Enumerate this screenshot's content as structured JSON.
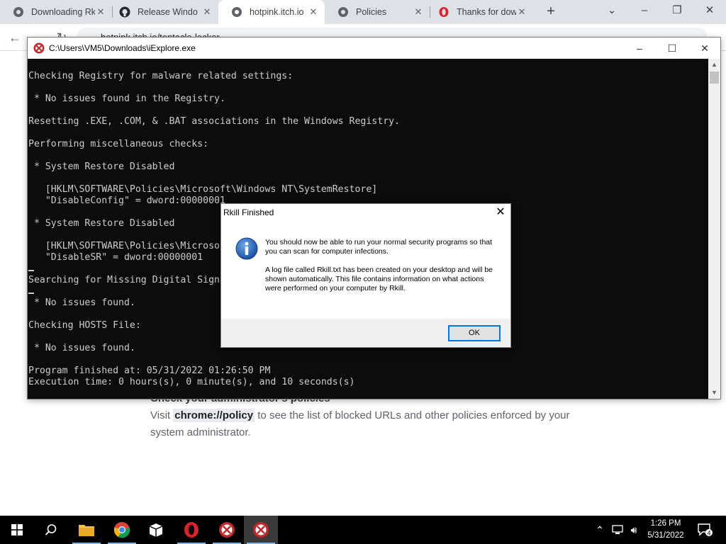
{
  "browser": {
    "tabs": [
      {
        "title": "Downloading Rk",
        "icon": "chrome-page-icon"
      },
      {
        "title": "Release Windo",
        "icon": "github-icon"
      },
      {
        "title": "hotpink.itch.io",
        "icon": "chrome-page-icon"
      },
      {
        "title": "Policies",
        "icon": "chrome-page-icon"
      },
      {
        "title": "Thanks for dow",
        "icon": "opera-icon"
      }
    ],
    "address": "hotpink.itch.io/tentacle-locker"
  },
  "page": {
    "heading": "Check your administrator's policies",
    "para_prefix": "Visit ",
    "para_code": "chrome://policy",
    "para_suffix": " to see the list of blocked URLs and other policies enforced by your system administrator."
  },
  "console": {
    "title": "C:\\Users\\VM5\\Downloads\\iExplore.exe",
    "lines": [
      "Checking Registry for malware related settings:",
      "",
      " * No issues found in the Registry.",
      "",
      "Resetting .EXE, .COM, & .BAT associations in the Windows Registry.",
      "",
      "Performing miscellaneous checks:",
      "",
      " * System Restore Disabled",
      "",
      "   [HKLM\\SOFTWARE\\Policies\\Microsoft\\Windows NT\\SystemRestore]",
      "   \"DisableConfig\" = dword:00000001",
      "",
      " * System Restore Disabled",
      "",
      "   [HKLM\\SOFTWARE\\Policies\\Microsoft\\Windows NT\\SystemRestore]",
      "   \"DisableSR\" = dword:00000001",
      "",
      "Searching for Missing Digital Signatures:",
      "",
      " * No issues found.",
      "",
      "Checking HOSTS File:",
      "",
      " * No issues found.",
      "",
      "Program finished at: 05/31/2022 01:26:50 PM",
      "Execution time: 0 hours(s), 0 minute(s), and 10 seconds(s)"
    ]
  },
  "dialog": {
    "title": "Rkill Finished",
    "message1": "You should now be able to run your normal security programs so that you can scan for computer infections.",
    "message2": "A log file called Rkill.txt has been created on your desktop and will be shown automatically.  This file contains information on what actions were performed on your computer by Rkill.",
    "ok_label": "OK"
  },
  "taskbar": {
    "time": "1:26 PM",
    "date": "5/31/2022",
    "notification_count": "4"
  }
}
